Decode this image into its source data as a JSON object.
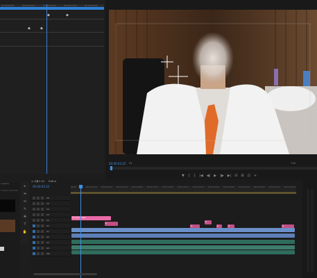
{
  "effect_controls": {
    "ruler_ticks": [
      "00:00:00:00",
      "00:00:05:00",
      "00:00:10:00",
      "00:00:15:00",
      "00:00:20:00",
      "00:00:25:00"
    ],
    "keyframe_a": "◆",
    "keyframe_b": "◆",
    "keyframe_c": "◆",
    "keyframe_d": "◆"
  },
  "program": {
    "timecode": "00:00:03:22",
    "fit": "Fit",
    "duration": "Full"
  },
  "transport": {
    "marker": "▼",
    "in": "{",
    "out": "}",
    "go_in": "|◀",
    "step_back": "◀|",
    "play": "▶",
    "step_fwd": "|▶",
    "go_out": "▶|",
    "lift": "⊟",
    "extract": "⊞",
    "export": "⊡",
    "settings": "+"
  },
  "project": {
    "label": "x.prproj",
    "count": "4 Items Selected"
  },
  "tools": [
    "▸",
    "⇼",
    "⇹",
    "✎",
    "✥",
    "T",
    "✋"
  ],
  "timeline": {
    "tabs": [
      "× 시퀀스 01",
      "Edit ≡"
    ],
    "timecode": "00:00:03:22",
    "ruler_ticks": [
      "00:00",
      "00:00:15:00",
      "00:00:30:00",
      "00:00:45:00",
      "00:01:00:00",
      "00:01:15:00",
      "00:01:30:00",
      "00:01:45:00",
      "00:02:00:00",
      "00:02:15:00",
      "00:02:30:00",
      "00:02:45:00",
      "00:03:00:00",
      "00:03:15:00",
      "00:03:30:00"
    ],
    "tracks": [
      {
        "name": "V6"
      },
      {
        "name": "V5"
      },
      {
        "name": "V4"
      },
      {
        "name": "V3"
      },
      {
        "name": "V2"
      },
      {
        "name": "V1"
      },
      {
        "name": "A1"
      },
      {
        "name": "A2"
      },
      {
        "name": "A3"
      },
      {
        "name": "A4"
      },
      {
        "name": "Mix"
      }
    ],
    "clip_title": "자막 인트로.mp4",
    "clip_small": "fx"
  }
}
